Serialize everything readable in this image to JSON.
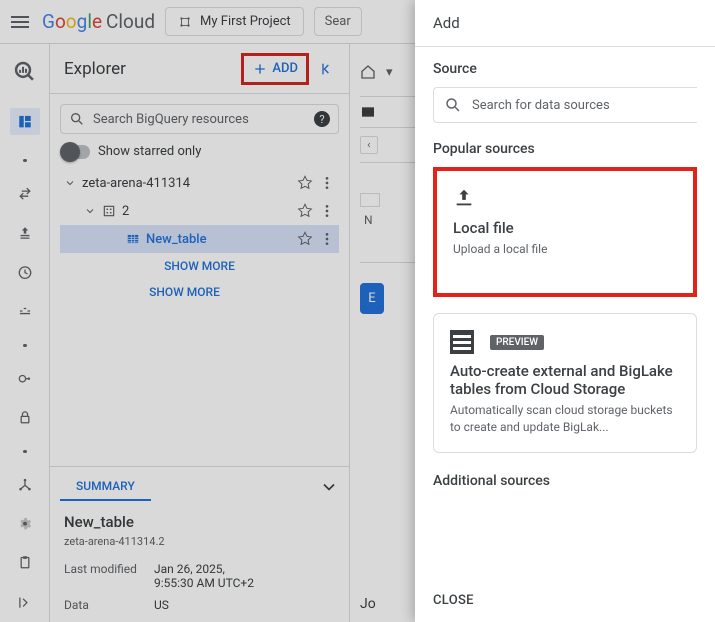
{
  "topbar": {
    "logo_cloud": "Cloud",
    "project_label": "My First Project",
    "search_label": "Sear"
  },
  "explorer": {
    "title": "Explorer",
    "add_label": "ADD",
    "search_placeholder": "Search BigQuery resources",
    "starred_label": "Show starred only",
    "project": "zeta-arena-411314",
    "dataset": "2",
    "table": "New_table",
    "show_more": "SHOW MORE"
  },
  "summary": {
    "tab": "SUMMARY",
    "table_name": "New_table",
    "table_path": "zeta-arena-411314.2",
    "last_modified_k": "Last modified",
    "last_modified_v1": "Jan 26, 2025,",
    "last_modified_v2": "9:55:30 AM UTC+2",
    "data_k": "Data",
    "data_v": "US"
  },
  "main": {
    "n": "N",
    "e": "E",
    "job": "Jo"
  },
  "drawer": {
    "title": "Add",
    "source_label": "Source",
    "search_placeholder": "Search for data sources",
    "popular_label": "Popular sources",
    "local_title": "Local file",
    "local_desc": "Upload a local file",
    "preview_badge": "PREVIEW",
    "biglake_title": "Auto-create external and BigLake tables from Cloud Storage",
    "biglake_desc": "Automatically scan cloud storage buckets to create and update BigLak...",
    "additional_label": "Additional sources",
    "close": "CLOSE"
  }
}
